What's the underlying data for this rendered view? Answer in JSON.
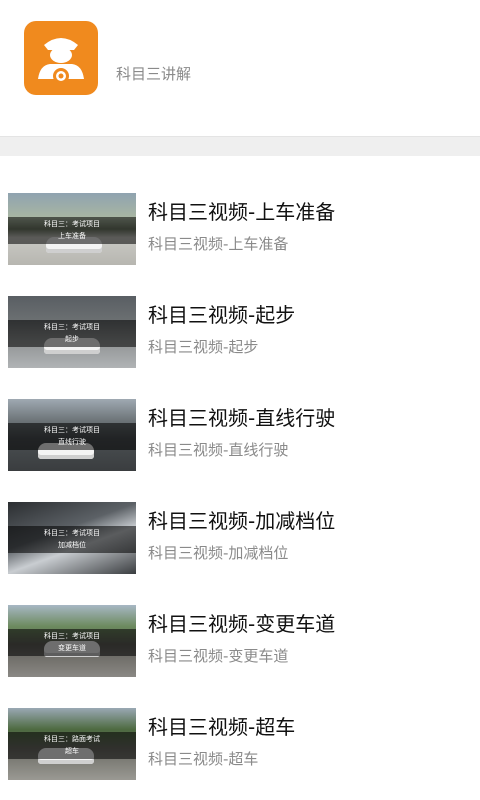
{
  "header": {
    "title": "",
    "subtitle": "科目三讲解",
    "icon": "driver-icon",
    "icon_color": "#f08a1e"
  },
  "list": [
    {
      "title": "科目三视频-上车准备",
      "subtitle": "科目三视频-上车准备",
      "thumb_caption_1": "科目三：考试项目",
      "thumb_caption_2": "上车准备"
    },
    {
      "title": "科目三视频-起步",
      "subtitle": "科目三视频-起步",
      "thumb_caption_1": "科目三：考试项目",
      "thumb_caption_2": "起步"
    },
    {
      "title": "科目三视频-直线行驶",
      "subtitle": "科目三视频-直线行驶",
      "thumb_caption_1": "科目三：考试项目",
      "thumb_caption_2": "直线行驶"
    },
    {
      "title": "科目三视频-加减档位",
      "subtitle": "科目三视频-加减档位",
      "thumb_caption_1": "科目三：考试项目",
      "thumb_caption_2": "加减档位"
    },
    {
      "title": "科目三视频-变更车道",
      "subtitle": "科目三视频-变更车道",
      "thumb_caption_1": "科目三：考试项目",
      "thumb_caption_2": "变更车道"
    },
    {
      "title": "科目三视频-超车",
      "subtitle": "科目三视频-超车",
      "thumb_caption_1": "科目三：路面考试",
      "thumb_caption_2": "超车"
    }
  ]
}
